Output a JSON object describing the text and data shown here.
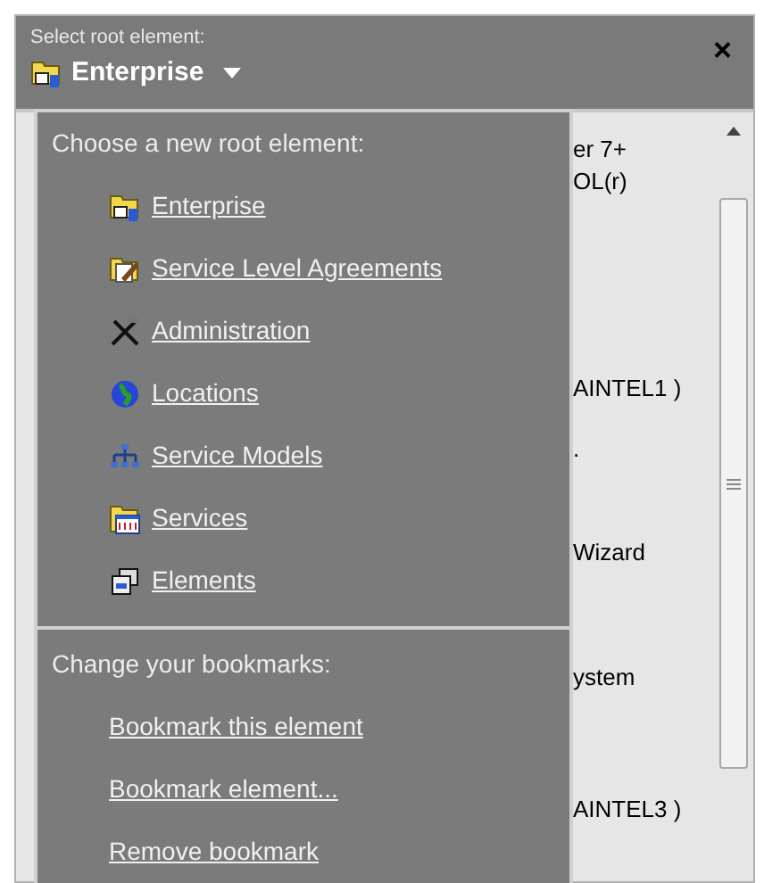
{
  "header": {
    "caption": "Select root element:",
    "current": "Enterprise",
    "close": "×"
  },
  "background_lines": [
    "er 7+",
    "OL(r)",
    "AINTEL1 )",
    ".",
    "Wizard",
    "ystem",
    "AINTEL3 )"
  ],
  "menu": {
    "sections": [
      {
        "heading": "Choose a new root element:",
        "items": [
          {
            "label": "Enterprise",
            "kind": "enterprise"
          },
          {
            "label": "Service Level Agreements",
            "kind": "sla"
          },
          {
            "label": "Administration",
            "kind": "tools"
          },
          {
            "label": "Locations",
            "kind": "globe"
          },
          {
            "label": "Service Models",
            "kind": "hierarchy"
          },
          {
            "label": "Services",
            "kind": "services"
          },
          {
            "label": "Elements",
            "kind": "windows"
          }
        ]
      },
      {
        "heading": "Change your bookmarks:",
        "items": [
          {
            "label": "Bookmark this element"
          },
          {
            "label": "Bookmark element..."
          },
          {
            "label": "Remove bookmark"
          }
        ]
      }
    ]
  }
}
